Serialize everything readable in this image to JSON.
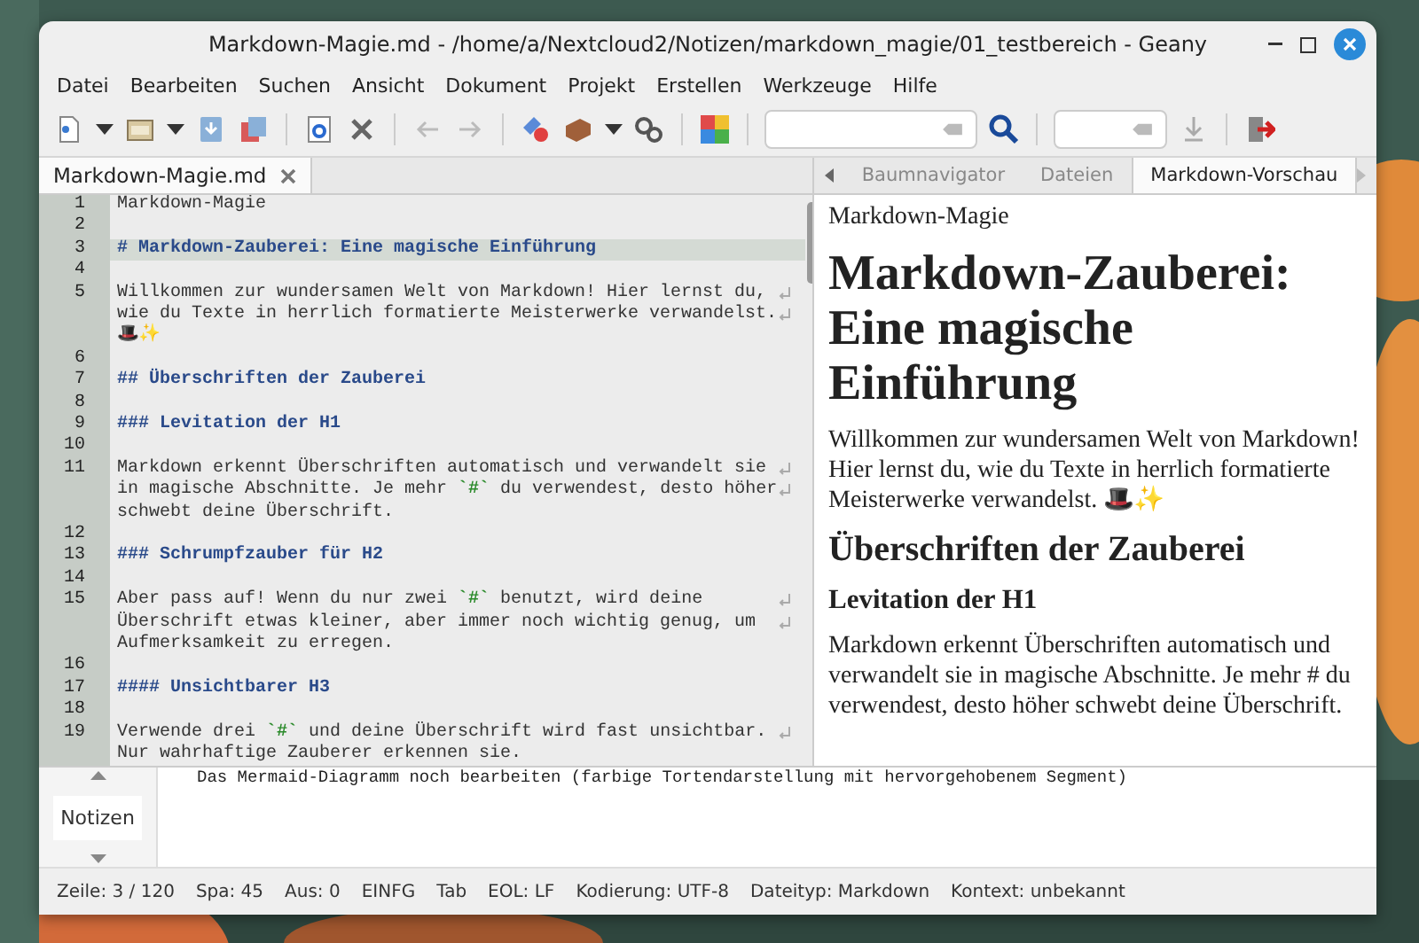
{
  "window": {
    "title": "Markdown-Magie.md - /home/a/Nextcloud2/Notizen/markdown_magie/01_testbereich - Geany"
  },
  "menu": [
    "Datei",
    "Bearbeiten",
    "Suchen",
    "Ansicht",
    "Dokument",
    "Projekt",
    "Erstellen",
    "Werkzeuge",
    "Hilfe"
  ],
  "editor_tabs": [
    {
      "label": "Markdown-Magie.md",
      "selected": true
    }
  ],
  "editor_lines": [
    {
      "number": "1",
      "kind": "text",
      "current": false,
      "rows": [
        "Markdown-Magie"
      ]
    },
    {
      "number": "2",
      "kind": "blank",
      "current": false
    },
    {
      "number": "3",
      "kind": "heading",
      "current": true,
      "rows": [
        "# Markdown-Zauberei: Eine magische Einführung"
      ]
    },
    {
      "number": "4",
      "kind": "blank",
      "current": false
    },
    {
      "number": "5",
      "kind": "text",
      "current": false,
      "rows": [
        "Willkommen zur wundersamen Welt von Markdown! Hier lernst du,",
        "wie du Texte in herrlich formatierte Meisterwerke verwandelst.",
        "🎩✨"
      ]
    },
    {
      "number": "6",
      "kind": "blank",
      "current": false
    },
    {
      "number": "7",
      "kind": "heading",
      "current": false,
      "rows": [
        "## Überschriften der Zauberei"
      ]
    },
    {
      "number": "8",
      "kind": "blank",
      "current": false
    },
    {
      "number": "9",
      "kind": "heading",
      "current": false,
      "rows": [
        "### Levitation der H1"
      ]
    },
    {
      "number": "10",
      "kind": "blank",
      "current": false
    },
    {
      "number": "11",
      "kind": "text",
      "current": false,
      "rows": [
        "Markdown erkennt Überschriften automatisch und verwandelt sie",
        "in magische Abschnitte. Je mehr `#` du verwendest, desto höher",
        "schwebt deine Überschrift."
      ]
    },
    {
      "number": "12",
      "kind": "blank",
      "current": false
    },
    {
      "number": "13",
      "kind": "heading",
      "current": false,
      "rows": [
        "### Schrumpfzauber für H2"
      ]
    },
    {
      "number": "14",
      "kind": "blank",
      "current": false
    },
    {
      "number": "15",
      "kind": "text",
      "current": false,
      "rows": [
        "Aber pass auf! Wenn du nur zwei `#` benutzt, wird deine",
        "Überschrift etwas kleiner, aber immer noch wichtig genug, um",
        "Aufmerksamkeit zu erregen."
      ]
    },
    {
      "number": "16",
      "kind": "blank",
      "current": false
    },
    {
      "number": "17",
      "kind": "heading",
      "current": false,
      "rows": [
        "#### Unsichtbarer H3"
      ]
    },
    {
      "number": "18",
      "kind": "blank",
      "current": false
    },
    {
      "number": "19",
      "kind": "text",
      "current": false,
      "rows": [
        "Verwende drei `#` und deine Überschrift wird fast unsichtbar.",
        "Nur wahrhaftige Zauberer erkennen sie."
      ]
    }
  ],
  "side_tabs": [
    {
      "label": "Baumnavigator",
      "selected": false
    },
    {
      "label": "Dateien",
      "selected": false
    },
    {
      "label": "Markdown-Vorschau",
      "selected": true
    }
  ],
  "preview": [
    {
      "kind": "p",
      "text": "Markdown-Magie"
    },
    {
      "kind": "h1",
      "text": "Markdown-Zauberei: Eine magische Einführung"
    },
    {
      "kind": "p",
      "text": "Willkommen zur wundersamen Welt von Markdown! Hier lernst du, wie du Texte in herrlich formatierte Meisterwerke verwandelst. 🎩✨"
    },
    {
      "kind": "h2",
      "text": "Überschriften der Zauberei"
    },
    {
      "kind": "h3",
      "text": "Levitation der H1"
    },
    {
      "kind": "p",
      "text": "Markdown erkennt Überschriften automatisch und verwandelt sie in magische Abschnitte. Je mehr # du verwendest, desto höher schwebt deine Überschrift."
    }
  ],
  "message_tabs": [
    {
      "label": "Notizen",
      "selected": true
    }
  ],
  "notes": "Das Mermaid-Diagramm noch bearbeiten (farbige Tortendarstellung mit hervorgehobenem Segment)",
  "status_bar": [
    "Zeile: 3 / 120",
    "Spa: 45",
    "Aus: 0",
    "EINFG",
    "Tab",
    "EOL: LF",
    "Kodierung: UTF-8",
    "Dateityp: Markdown",
    "Kontext: unbekannt"
  ]
}
